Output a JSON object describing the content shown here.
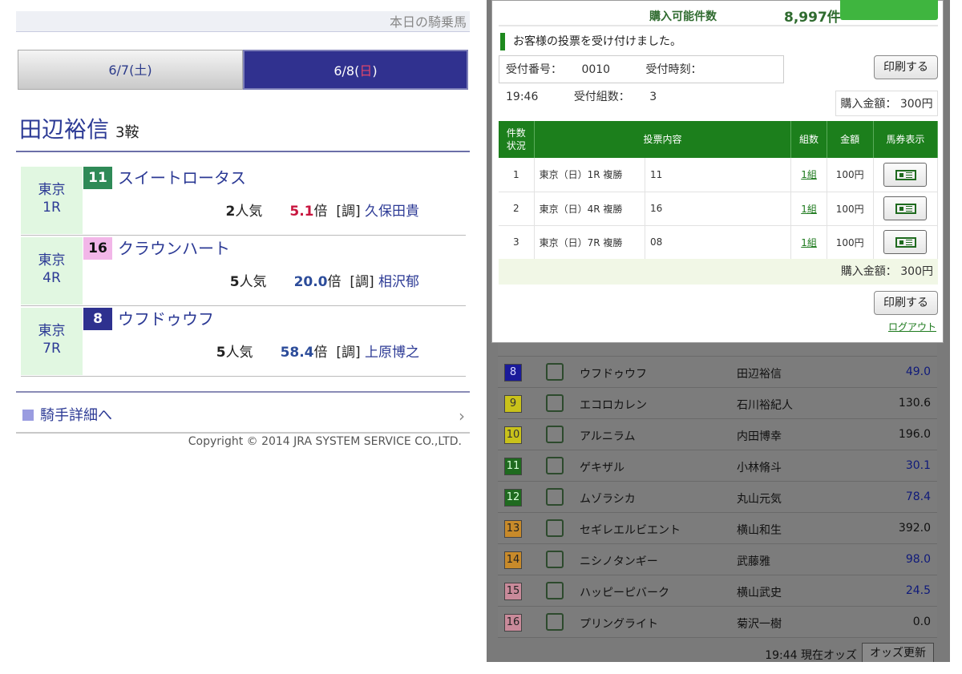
{
  "left": {
    "today_label": "本日の騎乗馬",
    "tabs": [
      {
        "date": "6/7(",
        "day": "土",
        "close": ")",
        "active": false
      },
      {
        "date": "6/8(",
        "day": "日",
        "close": ")",
        "active": true
      }
    ],
    "jockey_name": "田辺裕信",
    "ride_count": "3鞍",
    "rides": [
      {
        "track": "東京",
        "race": "1R",
        "num": "11",
        "num_bg": "#2f8a57",
        "num_color": "#ffffff",
        "horse": "スイートロータス",
        "pop": "2",
        "pop_suffix": "人気",
        "odds": "5.1",
        "odds_suffix": "倍",
        "trainer_prefix": "[調]",
        "trainer": "久保田貴",
        "odds_color": "red"
      },
      {
        "track": "東京",
        "race": "4R",
        "num": "16",
        "num_bg": "#f2b6e8",
        "num_color": "#111111",
        "horse": "クラウンハート",
        "pop": "5",
        "pop_suffix": "人気",
        "odds": "20.0",
        "odds_suffix": "倍",
        "trainer_prefix": "[調]",
        "trainer": "相沢郁",
        "odds_color": "blue"
      },
      {
        "track": "東京",
        "race": "7R",
        "num": "8",
        "num_bg": "#2e318f",
        "num_color": "#ffffff",
        "horse": "ウフドゥウフ",
        "pop": "5",
        "pop_suffix": "人気",
        "odds": "58.4",
        "odds_suffix": "倍",
        "trainer_prefix": "[調]",
        "trainer": "上原博之",
        "odds_color": "blue"
      }
    ],
    "detail_link": "騎手詳細へ",
    "copyright": "Copyright © 2014 JRA SYSTEM SERVICE CO.,LTD."
  },
  "modal": {
    "purchasable_label": "購入可能件数",
    "purchasable_count": "8,997件",
    "accepted_msg": "お客様の投票を受け付けました。",
    "receipt_no_label": "受付番号：",
    "receipt_no": "0010",
    "receipt_time_label": "受付時刻：",
    "receipt_time": "19:46",
    "receipt_sets_label": "受付組数：",
    "receipt_sets": "3",
    "print_label": "印刷する",
    "amount_label": "購入金額：",
    "amount": "300円",
    "headers": [
      "件数状況",
      "投票内容",
      "組数",
      "金額",
      "馬券表示"
    ],
    "header_line1": "件数",
    "header_line2": "状況",
    "bets": [
      {
        "no": "1",
        "race": "東京（日）1R 複勝",
        "horse": "11",
        "sets": "1組",
        "price": "100円"
      },
      {
        "no": "2",
        "race": "東京（日）4R 複勝",
        "horse": "16",
        "sets": "1組",
        "price": "100円"
      },
      {
        "no": "3",
        "race": "東京（日）7R 複勝",
        "horse": "08",
        "sets": "1組",
        "price": "100円"
      }
    ],
    "logout": "ログアウト"
  },
  "odds": {
    "rows": [
      {
        "num": "8",
        "bg": "#1a1a9a",
        "color": "#d8d8ff",
        "horse": "ウフドゥウフ",
        "jockey": "田辺裕信",
        "odds": "49.0",
        "blue": true
      },
      {
        "num": "9",
        "bg": "#c9c21a",
        "color": "#333333",
        "horse": "エコロカレン",
        "jockey": "石川裕紀人",
        "odds": "130.6",
        "blue": false
      },
      {
        "num": "10",
        "bg": "#c9c21a",
        "color": "#333333",
        "horse": "アルニラム",
        "jockey": "内田博幸",
        "odds": "196.0",
        "blue": false
      },
      {
        "num": "11",
        "bg": "#1f6a1f",
        "color": "#d8ffd8",
        "horse": "ゲキザル",
        "jockey": "小林脩斗",
        "odds": "30.1",
        "blue": true
      },
      {
        "num": "12",
        "bg": "#1f6a1f",
        "color": "#d8ffd8",
        "horse": "ムゾラシカ",
        "jockey": "丸山元気",
        "odds": "78.4",
        "blue": true
      },
      {
        "num": "13",
        "bg": "#c88a2a",
        "color": "#222222",
        "horse": "セギレエルビエント",
        "jockey": "横山和生",
        "odds": "392.0",
        "blue": false
      },
      {
        "num": "14",
        "bg": "#c88a2a",
        "color": "#222222",
        "horse": "ニシノタンギー",
        "jockey": "武藤雅",
        "odds": "98.0",
        "blue": true
      },
      {
        "num": "15",
        "bg": "#c98a9a",
        "color": "#222222",
        "horse": "ハッピーピバーク",
        "jockey": "横山武史",
        "odds": "24.5",
        "blue": true
      },
      {
        "num": "16",
        "bg": "#c98a9a",
        "color": "#222222",
        "horse": "プリングライト",
        "jockey": "菊沢一樹",
        "odds": "0.0",
        "blue": false
      }
    ],
    "time_label": "19:44 現在オッズ",
    "refresh_label": "オッズ更新"
  }
}
